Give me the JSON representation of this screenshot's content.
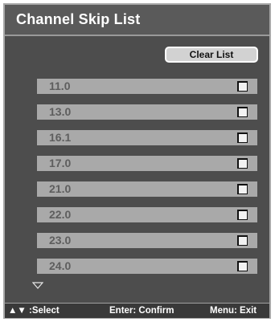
{
  "window": {
    "title": "Channel Skip List"
  },
  "clear_button": {
    "label": "Clear List"
  },
  "channels": [
    {
      "number": "11.0",
      "checked": false
    },
    {
      "number": "13.0",
      "checked": false
    },
    {
      "number": "16.1",
      "checked": false
    },
    {
      "number": "17.0",
      "checked": false
    },
    {
      "number": "21.0",
      "checked": false
    },
    {
      "number": "22.0",
      "checked": false
    },
    {
      "number": "23.0",
      "checked": false
    },
    {
      "number": "24.0",
      "checked": false
    }
  ],
  "footer": {
    "nav_arrows": "▲▼",
    "select_hint": ":Select",
    "confirm_hint": "Enter: Confirm",
    "exit_hint": "Menu: Exit"
  },
  "icons": {
    "scroll": "scroll-down-triangle-icon",
    "nav": "up-down-arrows-icon"
  },
  "colors": {
    "panel": "#4d4d4d",
    "row": "#a9a9a9",
    "button": "#d2d2d2",
    "footer": "#393939"
  }
}
